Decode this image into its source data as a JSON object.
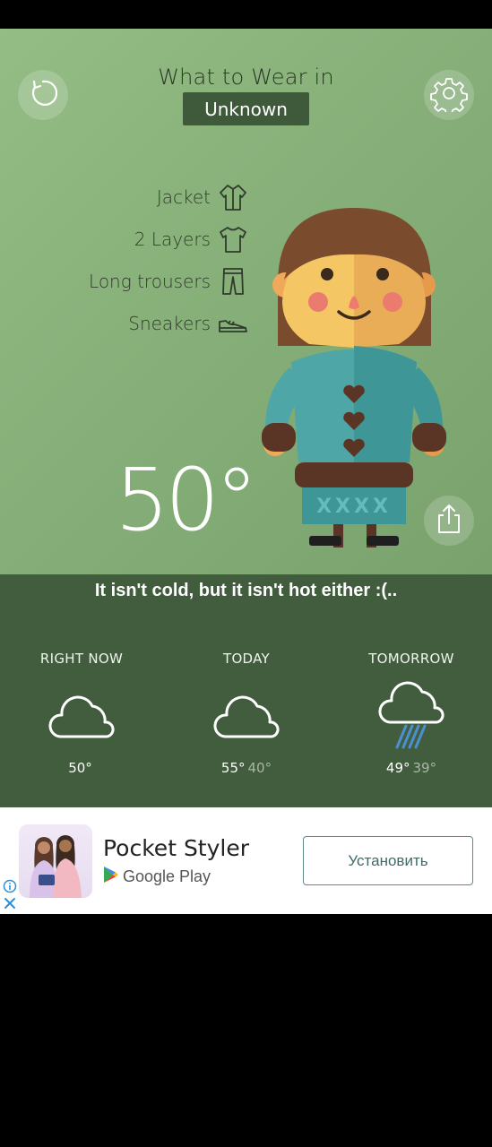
{
  "header": {
    "title": "What to Wear in",
    "location": "Unknown"
  },
  "outfit": [
    {
      "label": "Jacket",
      "icon": "jacket-icon"
    },
    {
      "label": "2 Layers",
      "icon": "shirt-icon"
    },
    {
      "label": "Long trousers",
      "icon": "trousers-icon"
    },
    {
      "label": "Sneakers",
      "icon": "sneakers-icon"
    }
  ],
  "current": {
    "temperature": "50°"
  },
  "forecast": {
    "message": "It isn't cold, but it isn't hot either :(..",
    "columns": [
      {
        "label": "RIGHT NOW",
        "icon": "cloud-icon",
        "high": "50°",
        "low": ""
      },
      {
        "label": "TODAY",
        "icon": "cloud-icon",
        "high": "55°",
        "low": "40°"
      },
      {
        "label": "TOMORROW",
        "icon": "rain-cloud-icon",
        "high": "49°",
        "low": "39°"
      }
    ]
  },
  "ad": {
    "app_name": "Pocket Styler",
    "store": "Google Play",
    "install_label": "Установить"
  },
  "colors": {
    "hero_bg": "#86ae78",
    "forecast_bg": "#425c3e",
    "badge_bg": "#3f5a3a",
    "sweater": "#4fa6a6",
    "hair": "#7a4b2c"
  }
}
